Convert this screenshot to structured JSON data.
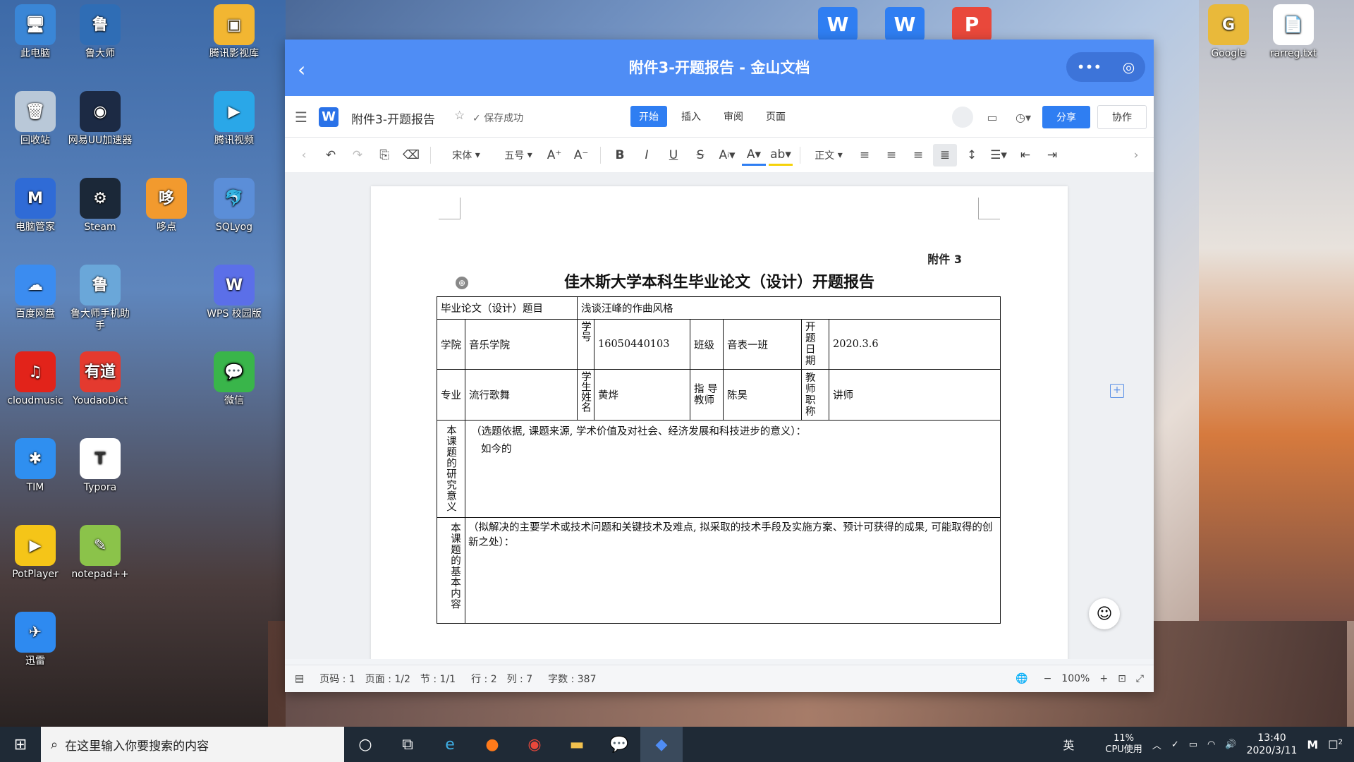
{
  "desktop_icons": [
    {
      "label": "此电脑",
      "color": "#3a86d6",
      "glyph": "🖥",
      "col": 0,
      "row": 0
    },
    {
      "label": "鲁大师",
      "color": "#2f6db5",
      "glyph": "鲁",
      "col": 1,
      "row": 0
    },
    {
      "label": "腾讯影视库",
      "color": "#f2b632",
      "glyph": "▣",
      "col": 3,
      "row": 0
    },
    {
      "label": "回收站",
      "color": "#b9c8d8",
      "glyph": "🗑",
      "col": 0,
      "row": 1
    },
    {
      "label": "网易UU加速器",
      "color": "#1c2a44",
      "glyph": "◉",
      "col": 1,
      "row": 1
    },
    {
      "label": "腾讯视频",
      "color": "#2aa7e8",
      "glyph": "▶",
      "col": 3,
      "row": 1
    },
    {
      "label": "电脑管家",
      "color": "#2f6bd6",
      "glyph": "M",
      "col": 0,
      "row": 2
    },
    {
      "label": "Steam",
      "color": "#1b2838",
      "glyph": "⚙",
      "col": 1,
      "row": 2
    },
    {
      "label": "哆点",
      "color": "#f29a2e",
      "glyph": "哆",
      "col": 2,
      "row": 2
    },
    {
      "label": "SQLyog",
      "color": "#5b8ed8",
      "glyph": "🐬",
      "col": 3,
      "row": 2
    },
    {
      "label": "百度网盘",
      "color": "#3b8cf0",
      "glyph": "☁",
      "col": 0,
      "row": 3
    },
    {
      "label": "鲁大师手机助手",
      "color": "#6aa7d9",
      "glyph": "鲁",
      "col": 1,
      "row": 3
    },
    {
      "label": "WPS 校园版",
      "color": "#5b6fe8",
      "glyph": "W",
      "col": 3,
      "row": 3
    },
    {
      "label": "cloudmusic",
      "color": "#e2231a",
      "glyph": "♫",
      "col": 0,
      "row": 4
    },
    {
      "label": "YoudaoDict",
      "color": "#e43a2f",
      "glyph": "有道",
      "col": 1,
      "row": 4
    },
    {
      "label": "微信",
      "color": "#39b54a",
      "glyph": "💬",
      "col": 3,
      "row": 4
    },
    {
      "label": "TIM",
      "color": "#2f8ff0",
      "glyph": "✱",
      "col": 0,
      "row": 5
    },
    {
      "label": "Typora",
      "color": "#ffffff",
      "glyph": "T",
      "col": 1,
      "row": 5
    },
    {
      "label": "PotPlayer",
      "color": "#f5c518",
      "glyph": "▶",
      "col": 0,
      "row": 6
    },
    {
      "label": "notepad++",
      "color": "#8bc34a",
      "glyph": "✎",
      "col": 1,
      "row": 6
    },
    {
      "label": "迅雷",
      "color": "#2e8af0",
      "glyph": "✈",
      "col": 0,
      "row": 7
    },
    {
      "label": "Google",
      "color": "#e9b93a",
      "glyph": "G",
      "col": 9,
      "row": 0
    },
    {
      "label": "rarreg.txt",
      "color": "#ffffff",
      "glyph": "📄",
      "col": 10,
      "row": 0
    }
  ],
  "top_apps": [
    {
      "glyph": "W",
      "color": "#2f7ef2"
    },
    {
      "glyph": "W",
      "color": "#2f7ef2"
    },
    {
      "glyph": "P",
      "color": "#e9483b"
    }
  ],
  "window": {
    "title": "附件3-开题报告 - 金山文档",
    "back_glyph": "‹",
    "pill_left": "•••",
    "pill_right": "◎"
  },
  "toolbar": {
    "doc_name": "附件3-开题报告",
    "save_status": "保存成功",
    "tabs": [
      "开始",
      "插入",
      "审阅",
      "页面"
    ],
    "share": "分享",
    "collab": "协作"
  },
  "format": {
    "font": "宋体",
    "size": "五号",
    "style": "正文"
  },
  "document": {
    "annex": "附件 3",
    "title": "佳木斯大学本科生毕业论文（设计）开题报告",
    "topic_label": "毕业论文（设计）题目",
    "topic_value": "浅谈汪峰的作曲风格",
    "college_label": "学院",
    "college_value": "音乐学院",
    "student_no_label": "学号",
    "student_no_value": "16050440103",
    "class_label": "班级",
    "class_value": "音表一班",
    "date_label": "开题日期",
    "date_value": "2020.3.6",
    "major_label": "专业",
    "major_value": "流行歌舞",
    "student_name_label": "学生姓名",
    "student_name_value": "黄烨",
    "advisor_label": "指 导教师",
    "advisor_value": "陈昊",
    "title_rank_label": "教师职称",
    "title_rank_value": "讲师",
    "significance_label": "本课题的研究意义",
    "significance_prompt": "（选题依据, 课题来源, 学术价值及对社会、经济发展和科技进步的意义）：",
    "significance_text": "如今的",
    "content_label": "本课题的基本内容",
    "content_prompt": "（拟解决的主要学术或技术问题和关键技术及难点, 拟采取的技术手段及实施方案、预计可获得的成果, 可能取得的创新之处）："
  },
  "status": {
    "page_code": "页码 : 1",
    "pages": "页面 : 1/2",
    "section": "节 : 1/1",
    "row": "行 : 2",
    "col": "列 : 7",
    "words": "字数 : 387",
    "zoom": "100%"
  },
  "taskbar": {
    "search_placeholder": "在这里输入你要搜索的内容",
    "cpu_pct": "11%",
    "cpu_label": "CPU使用",
    "time": "13:40",
    "date": "2020/3/11",
    "notif_count": "2",
    "ime": "英"
  }
}
